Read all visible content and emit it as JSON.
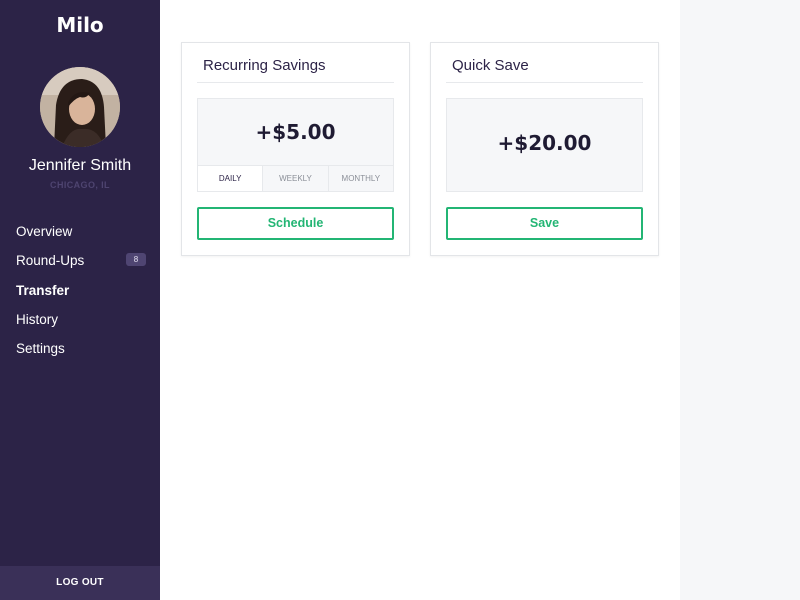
{
  "app": {
    "brand": "Milo"
  },
  "user": {
    "name": "Jennifer Smith",
    "location": "CHICAGO, IL"
  },
  "nav": {
    "items": [
      {
        "label": "Overview",
        "active": false
      },
      {
        "label": "Round-Ups",
        "active": false,
        "badge": "8"
      },
      {
        "label": "Transfer",
        "active": true
      },
      {
        "label": "History",
        "active": false
      },
      {
        "label": "Settings",
        "active": false
      }
    ],
    "logout_label": "LOG OUT"
  },
  "cards": {
    "recurring": {
      "title": "Recurring Savings",
      "amount": "+$5.00",
      "frequencies": [
        "DAILY",
        "WEEKLY",
        "MONTHLY"
      ],
      "selected_frequency": "DAILY",
      "button_label": "Schedule"
    },
    "quick": {
      "title": "Quick Save",
      "amount": "+$20.00",
      "button_label": "Save"
    }
  },
  "colors": {
    "sidebar_bg": "#2c2347",
    "accent_green": "#23b574",
    "panel_bg": "#f6f7f9"
  }
}
